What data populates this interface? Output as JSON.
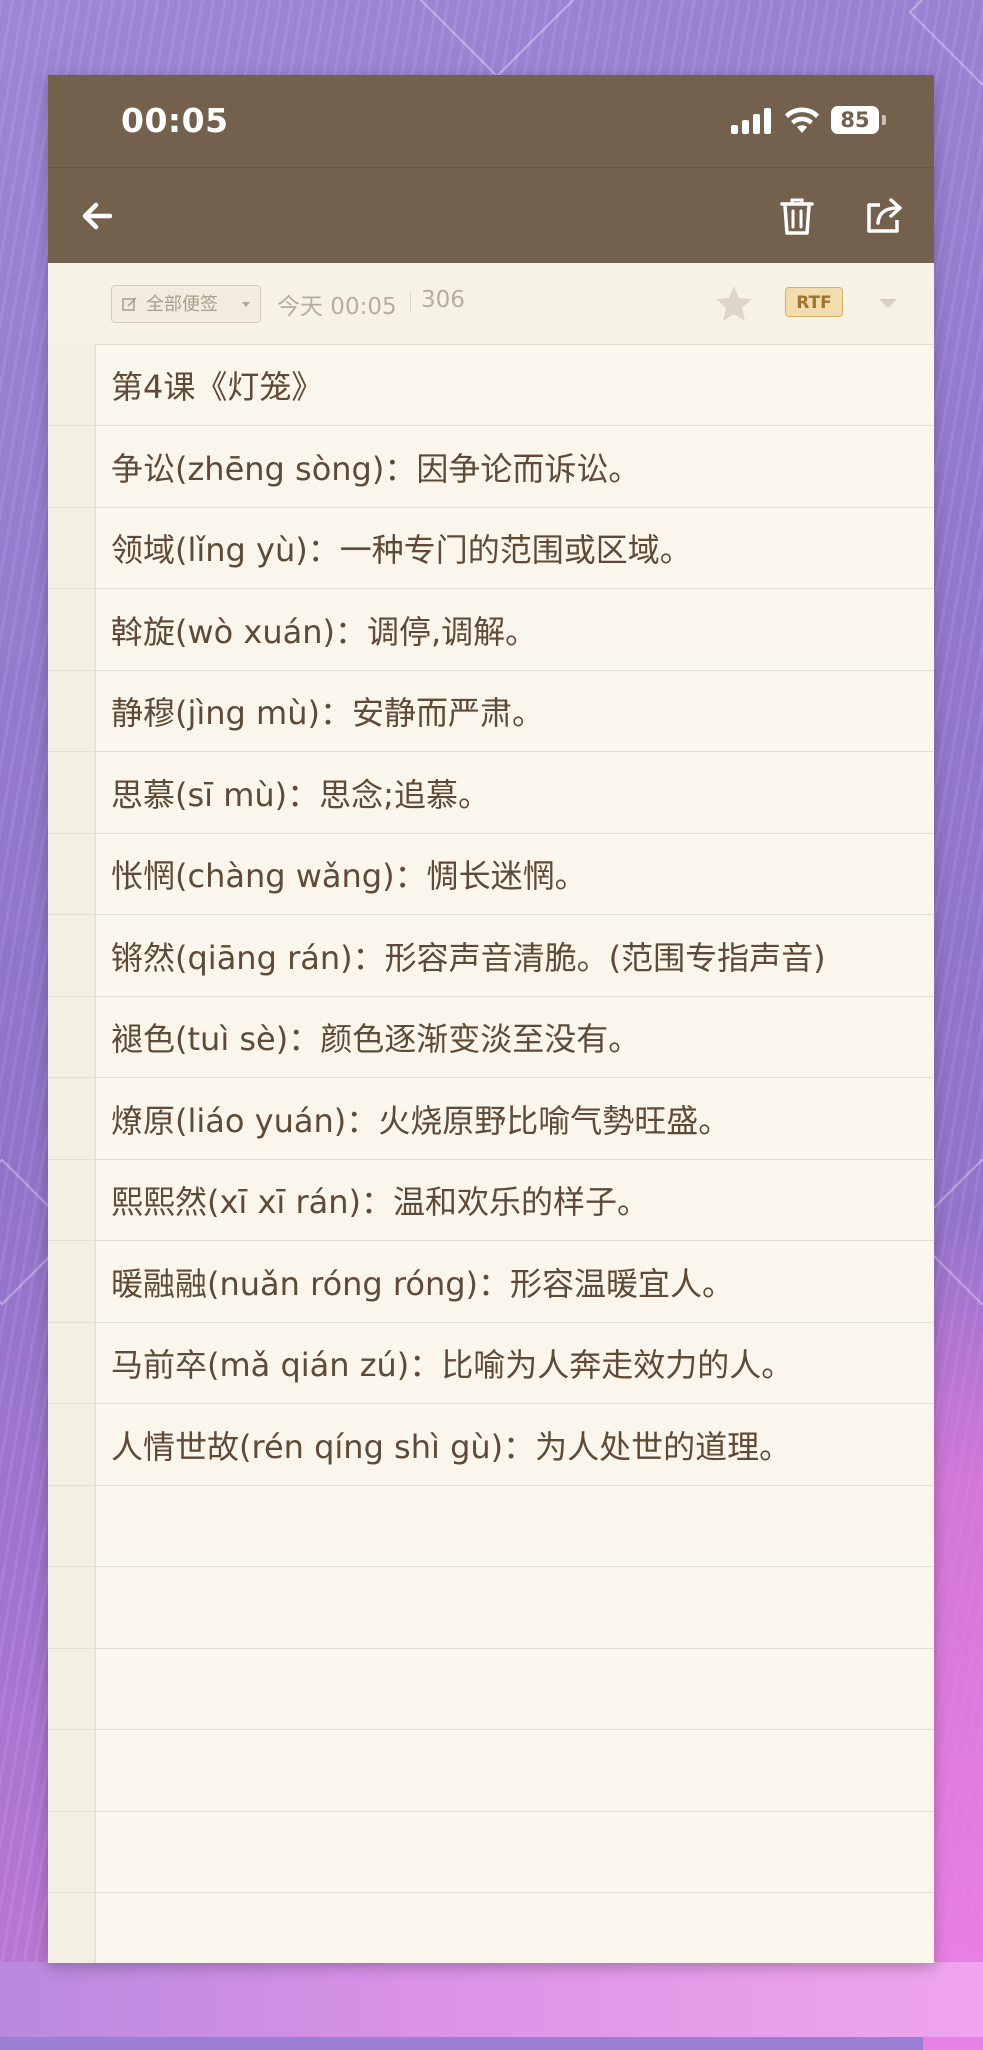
{
  "status_bar": {
    "time": "00:05",
    "battery": "85"
  },
  "toolbar": {
    "back_icon": "arrow-left-icon",
    "delete_icon": "trash-icon",
    "share_icon": "share-icon"
  },
  "meta": {
    "tag_label": "全部便签",
    "date": "今天 00:05",
    "char_count": "306",
    "format_badge": "RTF"
  },
  "note": {
    "lines": [
      "第4课《灯笼》",
      "争讼(zhēng sòng)：因争论而诉讼。",
      "领域(lǐng yù)：一种专门的范围或区域。",
      "斡旋(wò xuán)：调停,调解。",
      "静穆(jìng mù)：安静而严肃。",
      "思慕(sī mù)：思念;追慕。",
      "怅惘(chàng wǎng)：惆长迷惘。",
      "锵然(qiāng rán)：形容声音清脆。(范围专指声音)",
      "褪色(tuì sè)：颜色逐渐变淡至没有。",
      "燎原(liáo yuán)：火烧原野比喻气勢旺盛。",
      "熙熙然(xī xī rán)：温和欢乐的样子。",
      "暖融融(nuǎn róng róng)：形容温暖宜人。",
      "马前卒(mǎ qián zú)：比喻为人奔走效力的人。",
      "人情世故(rén qíng shì gù)：为人处世的道理。",
      "",
      "",
      "",
      "",
      "",
      ""
    ]
  },
  "colors": {
    "header_bg": "#73614d",
    "paper_bg": "#faf6ec",
    "text": "#5e4a36",
    "background": "#9b7fd4"
  }
}
